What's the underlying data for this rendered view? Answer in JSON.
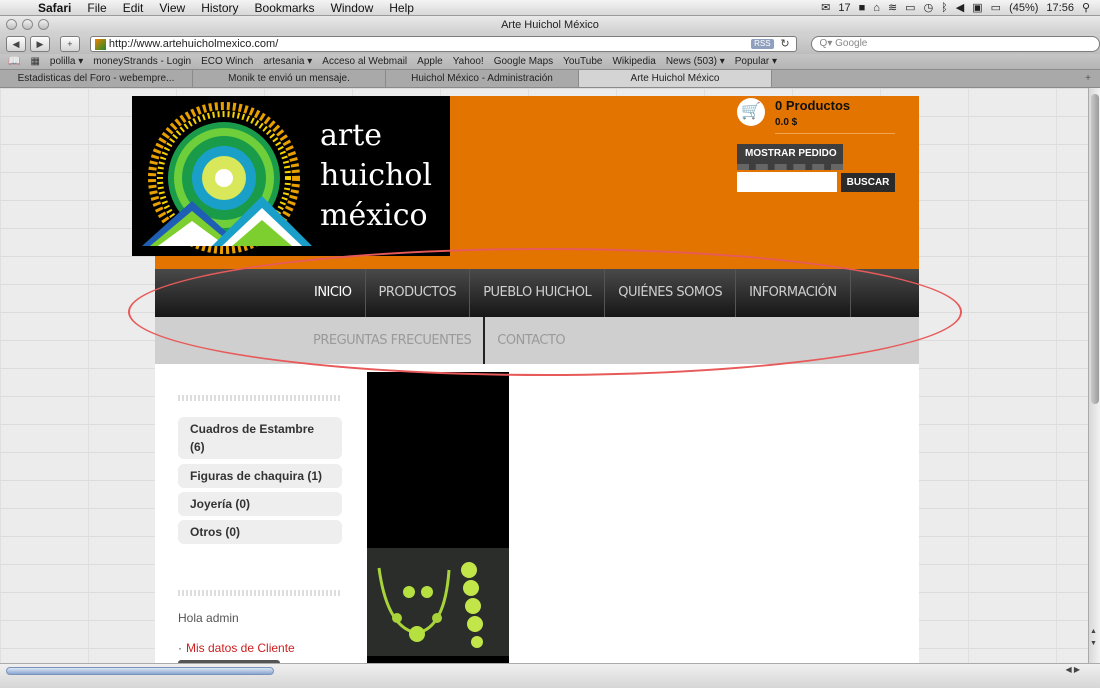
{
  "menubar": {
    "app": "Safari",
    "items": [
      "File",
      "Edit",
      "View",
      "History",
      "Bookmarks",
      "Window",
      "Help"
    ],
    "status_number": "17",
    "battery": "(45%)",
    "clock": "17:56"
  },
  "window": {
    "title": "Arte Huichol México"
  },
  "toolbar": {
    "url": "http://www.artehuicholmexico.com/",
    "rss": "RSS",
    "search_placeholder": "Q▾ Google"
  },
  "bookmarks": [
    "polilla ▾",
    "moneyStrands - Login",
    "ECO Winch",
    "artesania ▾",
    "Acceso al Webmail",
    "Apple",
    "Yahoo!",
    "Google Maps",
    "YouTube",
    "Wikipedia",
    "News (503) ▾",
    "Popular ▾"
  ],
  "tabs": [
    {
      "label": "Estadisticas del Foro - webempre..."
    },
    {
      "label": "Monik te envió un mensaje."
    },
    {
      "label": "Huichol México - Administración"
    },
    {
      "label": "Arte Huichol México"
    }
  ],
  "site": {
    "logo_lines": [
      "arte",
      "huichol",
      "méxico"
    ],
    "cart": {
      "count": "0 Productos",
      "total": "0.0 $",
      "show_order": "MOSTRAR PEDIDO",
      "search_button": "BUSCAR"
    },
    "nav": [
      "INICIO",
      "PRODUCTOS",
      "PUEBLO HUICHOL",
      "QUIÉNES SOMOS",
      "INFORMACIÓN"
    ],
    "subnav": [
      "PREGUNTAS FRECUENTES",
      "CONTACTO"
    ],
    "categories": [
      "Cuadros de Estambre (6)",
      "Figuras de chaquira (1)",
      "Joyería (0)",
      "Otros (0)"
    ],
    "greeting": "Hola admin",
    "my_data_link": "Mis datos de Cliente"
  },
  "colors": {
    "accent_orange": "#e37400",
    "nav_dark": "#2a2a2a",
    "link_red": "#cc1f1f",
    "annotation_red": "#e85a5a"
  }
}
